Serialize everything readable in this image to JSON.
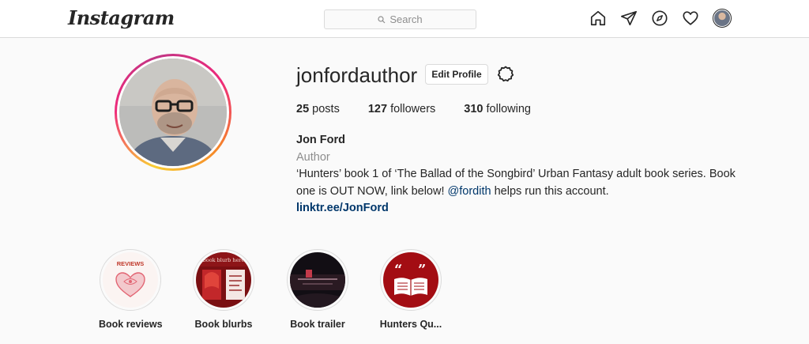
{
  "header": {
    "logo": "Instagram",
    "search_placeholder": "Search",
    "icons": [
      "home-icon",
      "direct-icon",
      "explore-icon",
      "activity-icon",
      "profile-avatar"
    ]
  },
  "profile": {
    "username": "jonfordauthor",
    "edit_label": "Edit Profile",
    "stats": {
      "posts_count": "25",
      "posts_label": "posts",
      "followers_count": "127",
      "followers_label": "followers",
      "following_count": "310",
      "following_label": "following"
    },
    "full_name": "Jon Ford",
    "category": "Author",
    "bio_text_1": "‘Hunters’ book 1 of ‘The Ballad of the Songbird’ Urban Fantasy adult book series. Book one is OUT NOW, link below! ",
    "bio_mention": "@fordith",
    "bio_text_2": " helps run this account.",
    "link": "linktr.ee/JonFord"
  },
  "highlights": [
    {
      "label": "Book reviews",
      "image_text": "REVIEWS"
    },
    {
      "label": "Book blurbs",
      "image_text": "book blurb here"
    },
    {
      "label": "Book trailer"
    },
    {
      "label": "Hunters Qu..."
    }
  ],
  "colors": {
    "background": "#fafafa",
    "text": "#262626",
    "muted": "#8e8e8e",
    "link": "#00376b",
    "border": "#dbdbdb"
  }
}
